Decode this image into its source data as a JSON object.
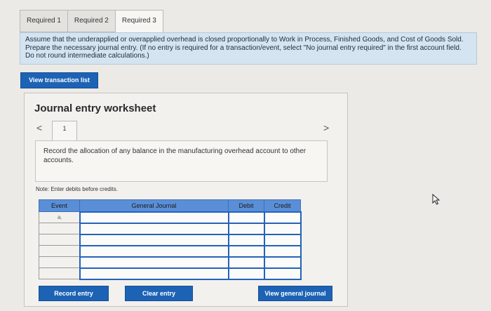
{
  "tabs": [
    "Required 1",
    "Required 2",
    "Required 3"
  ],
  "instructions": "Assume that the underapplied or overapplied overhead is closed proportionally to Work in Process, Finished Goods, and Cost of Goods Sold. Prepare the necessary journal entry. (If no entry is required for a transaction/event, select \"No journal entry required\" in the first account field. Do not round intermediate calculations.)",
  "view_transaction_list": "View transaction list",
  "worksheet": {
    "title": "Journal entry worksheet",
    "page": "1",
    "nav_prev": "<",
    "nav_next": ">",
    "description": "Record the allocation of any balance in the manufacturing overhead account to other accounts.",
    "note": "Note: Enter debits before credits."
  },
  "table": {
    "headers": [
      "Event",
      "General Journal",
      "Debit",
      "Credit"
    ],
    "rows": [
      {
        "event": "a."
      },
      {
        "event": ""
      },
      {
        "event": ""
      },
      {
        "event": ""
      },
      {
        "event": ""
      },
      {
        "event": ""
      }
    ]
  },
  "buttons": {
    "record": "Record entry",
    "clear": "Clear entry",
    "view_general_journal": "View general journal"
  }
}
